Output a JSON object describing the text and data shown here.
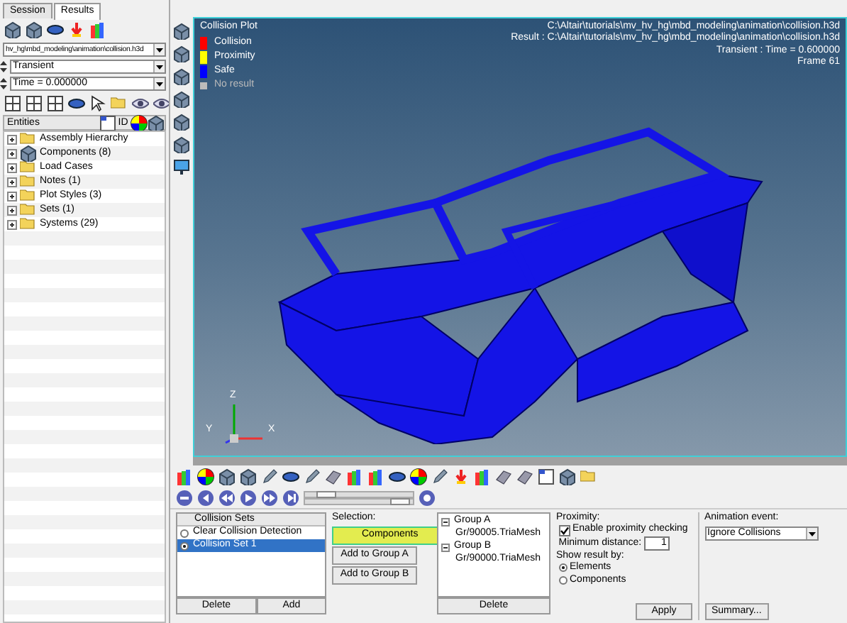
{
  "tabs": [
    {
      "label": "Session",
      "selected": false
    },
    {
      "label": "Results",
      "selected": true
    }
  ],
  "file_path": "hv_hg\\mbd_modeling\\animation\\collision.h3d",
  "analysis": "Transient",
  "time": "Time = 0.000000",
  "entities_header": {
    "label": "Entities",
    "id": "ID"
  },
  "tree": [
    {
      "label": "Assembly Hierarchy"
    },
    {
      "label": "Components (8)"
    },
    {
      "label": "Load Cases"
    },
    {
      "label": "Notes (1)"
    },
    {
      "label": "Plot Styles (3)"
    },
    {
      "label": "Sets  (1)"
    },
    {
      "label": "Systems (29)"
    }
  ],
  "viewport": {
    "title": "Collision Plot",
    "legend": [
      {
        "label": "Collision",
        "color": "#ff0000"
      },
      {
        "label": "Proximity",
        "color": "#ffff00"
      },
      {
        "label": "Safe",
        "color": "#0000ff"
      }
    ],
    "no_result": "No result",
    "info": [
      "C:\\Altair\\tutorials\\mv_hv_hg\\mbd_modeling\\animation\\collision.h3d",
      "Result : C:\\Altair\\tutorials\\mv_hv_hg\\mbd_modeling\\animation\\collision.h3d",
      "Transient : Time = 0.600000",
      "Frame 61"
    ],
    "axes": {
      "y": "Y",
      "z": "Z",
      "x": "X"
    }
  },
  "frame_slider": {
    "level": 0.12
  },
  "speed_slider": {
    "level": 0.93
  },
  "collision_sets": {
    "header": "Collision Sets",
    "items": [
      {
        "label": "Clear Collision Detection",
        "selected": false
      },
      {
        "label": "Collision Set 1",
        "selected": true
      }
    ],
    "buttons": [
      "Delete",
      "Add"
    ]
  },
  "selection": {
    "label": "Selection:",
    "mode": "Components",
    "buttons": [
      "Add to Group A",
      "Add to Group B"
    ]
  },
  "groups": {
    "tree": [
      {
        "label": "Group A",
        "children": [
          {
            "label": "Gr/90005.TriaMesh"
          }
        ]
      },
      {
        "label": "Group B",
        "children": [
          {
            "label": "Gr/90000.TriaMesh"
          }
        ]
      }
    ],
    "button": "Delete"
  },
  "proximity": {
    "label": "Proximity:",
    "enable": {
      "label": "Enable proximity checking",
      "checked": true
    },
    "min_distance_label": "Minimum distance:",
    "min_distance": "1",
    "show_by_label": "Show result by:",
    "show_by": [
      {
        "label": "Elements",
        "selected": true
      },
      {
        "label": "Components",
        "selected": false
      }
    ],
    "apply": "Apply"
  },
  "animation": {
    "label": "Animation event:",
    "value": "Ignore Collisions",
    "summary": "Summary..."
  }
}
